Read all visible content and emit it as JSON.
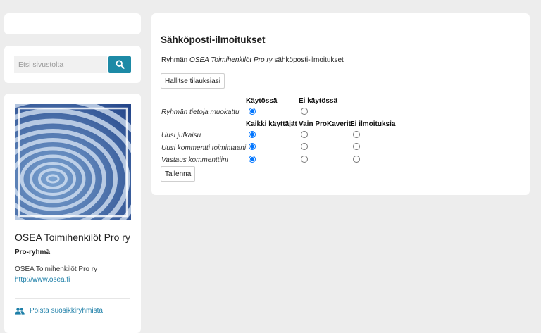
{
  "search": {
    "placeholder": "Etsi sivustolta",
    "button_icon": "search-icon"
  },
  "group": {
    "name": "OSEA Toimihenkilöt Pro ry",
    "type": "Pro-ryhmä",
    "description": "OSEA Toimihenkilöt Pro ry",
    "link": "http://www.osea.fi",
    "unfavorite_icon": "people-icon",
    "unfavorite_label": "Poista suosikkiryhmistä"
  },
  "notifications": {
    "title": "Sähköposti-ilmoitukset",
    "desc_prefix": "Ryhmän ",
    "desc_group": "OSEA Toimihenkilöt Pro ry",
    "desc_suffix": " sähköposti-ilmoitukset",
    "manage_button": "Hallitse tilauksiasi",
    "edit_section": {
      "columns": [
        "Käytössä",
        "Ei käytössä"
      ],
      "row_label": "Ryhmän tietoja muokattu",
      "selected": "Käytössä"
    },
    "activity_section": {
      "columns": [
        "Kaikki käyttäjät",
        "Vain ProKaverit",
        "Ei ilmoituksia"
      ],
      "rows": [
        {
          "label": "Uusi julkaisu",
          "selected": "Kaikki käyttäjät"
        },
        {
          "label": "Uusi kommentti toimintaani",
          "selected": "Kaikki käyttäjät"
        },
        {
          "label": "Vastaus kommenttiini",
          "selected": "Kaikki käyttäjät"
        }
      ]
    },
    "save_button": "Tallenna"
  },
  "colors": {
    "accent": "#1d8aa6",
    "link": "#1d7fa8",
    "background": "#ededed"
  }
}
